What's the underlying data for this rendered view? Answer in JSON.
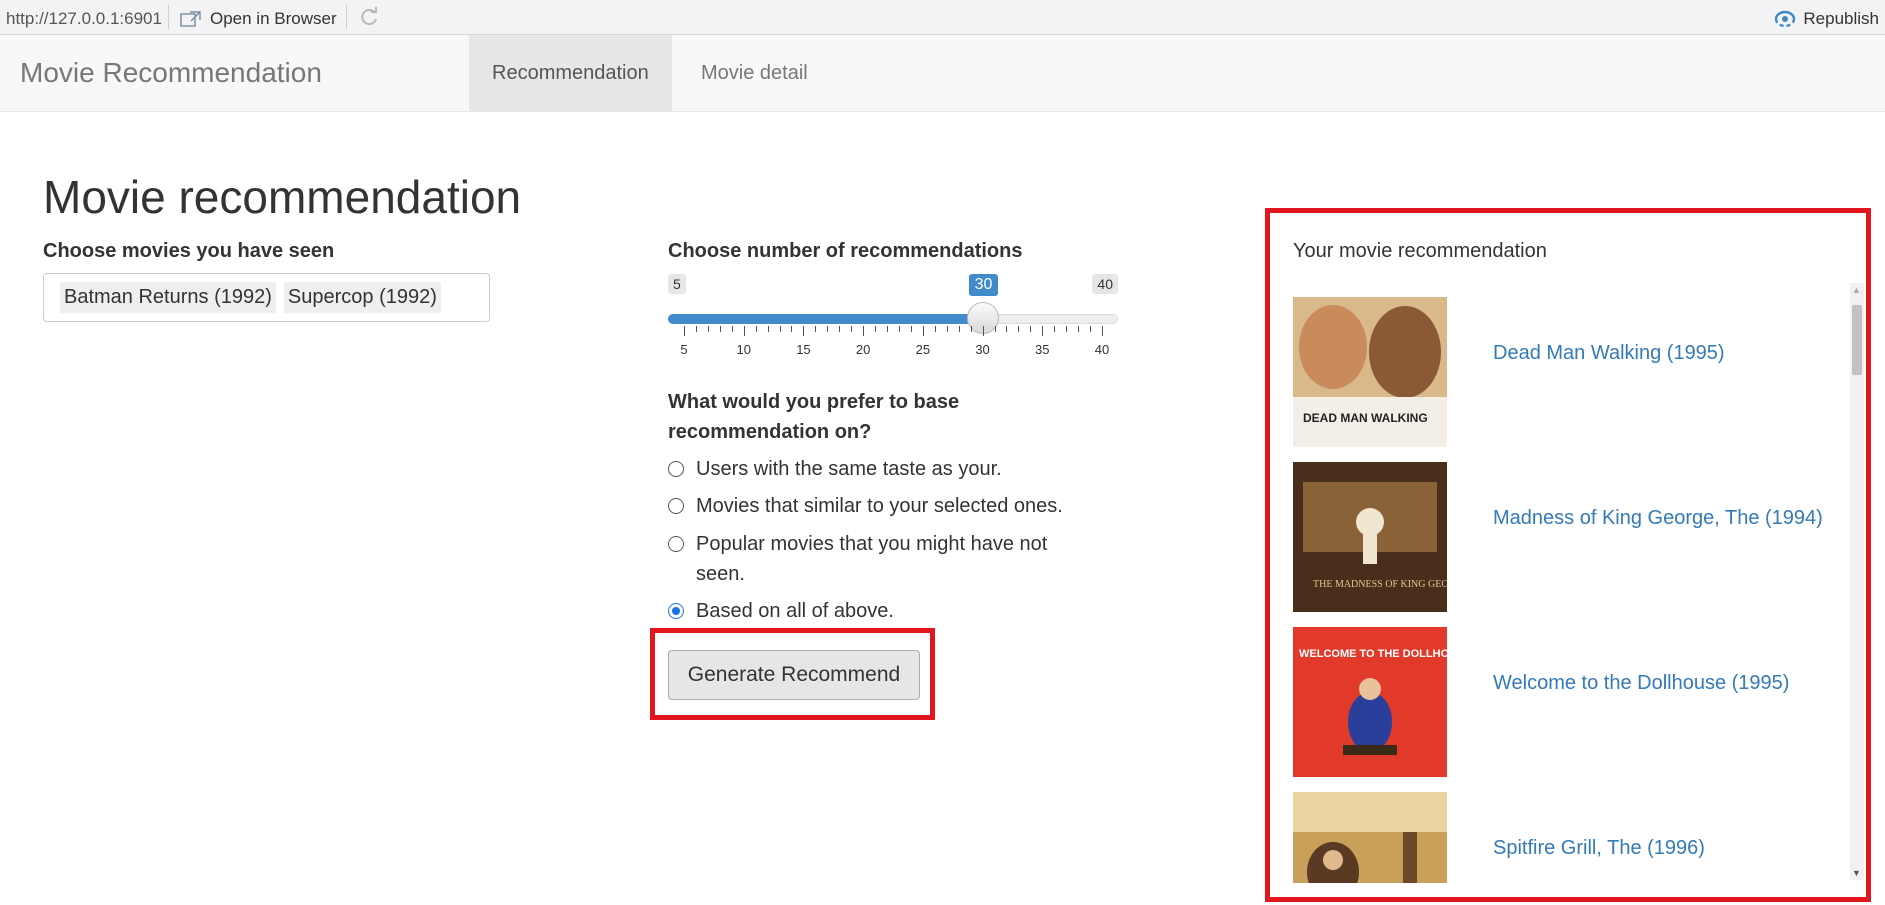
{
  "viewer": {
    "url": "http://127.0.0.1:6901",
    "open_browser": "Open in Browser",
    "republish": "Republish"
  },
  "navbar": {
    "brand": "Movie Recommendation",
    "tabs": [
      "Recommendation",
      "Movie detail"
    ],
    "active_tab": "Recommendation"
  },
  "page": {
    "title": "Movie recommendation",
    "choose_label": "Choose movies you have seen",
    "selected_movies": [
      "Batman Returns (1992)",
      "Supercop (1992)"
    ],
    "slider": {
      "label": "Choose number of recommendations",
      "min": 5,
      "max": 40,
      "value": 30,
      "min_label": "5",
      "max_label": "40",
      "value_label": "30",
      "ticks": [
        "5",
        "10",
        "15",
        "20",
        "25",
        "30",
        "35",
        "40"
      ]
    },
    "radio": {
      "label": "What would you prefer to base recommendation on?",
      "options": [
        "Users with the same taste as your.",
        "Movies that similar to your selected ones.",
        "Popular movies that you might have not seen.",
        "Based on all of above."
      ],
      "selected_index": 3
    },
    "generate_label": "Generate Recommend"
  },
  "results": {
    "title": "Your movie recommendation",
    "movies": [
      {
        "title": "Dead Man Walking (1995)",
        "poster_text": "DEAD MAN WALKING"
      },
      {
        "title": "Madness of King George, The (1994)",
        "poster_text": "THE MADNESS OF KING GEORGE"
      },
      {
        "title": "Welcome to the Dollhouse (1995)",
        "poster_text": "WELCOME TO THE DOLLHOUSE"
      },
      {
        "title": "Spitfire Grill, The (1996)",
        "poster_text": ""
      }
    ]
  },
  "colors": {
    "accent": "#428bca",
    "link": "#337ab7",
    "highlight": "#e3151e"
  }
}
